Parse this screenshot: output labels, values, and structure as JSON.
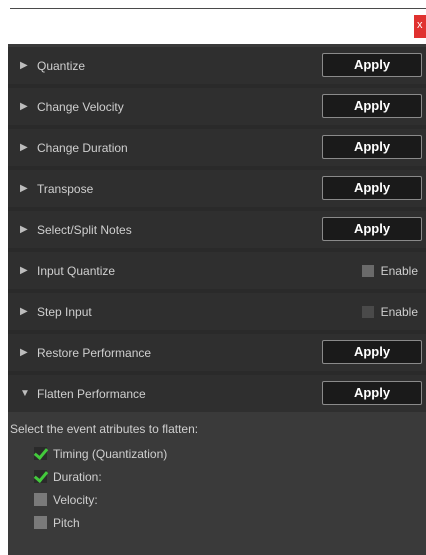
{
  "window": {
    "close_label": "x"
  },
  "rows": [
    {
      "label": "Quantize",
      "control": "Apply"
    },
    {
      "label": "Change Velocity",
      "control": "Apply"
    },
    {
      "label": "Change Duration",
      "control": "Apply"
    },
    {
      "label": "Transpose",
      "control": "Apply"
    },
    {
      "label": "Select/Split Notes",
      "control": "Apply"
    },
    {
      "label": "Input Quantize",
      "control": "Enable",
      "enabled": false
    },
    {
      "label": "Step Input",
      "control": "Enable",
      "enabled": false
    },
    {
      "label": "Restore Performance",
      "control": "Apply"
    },
    {
      "label": "Flatten Performance",
      "control": "Apply",
      "expanded": true
    }
  ],
  "flatten": {
    "prompt": "Select the event atributes to flatten:",
    "options": [
      {
        "label": "Timing (Quantization)",
        "checked": true
      },
      {
        "label": "Duration:",
        "checked": true
      },
      {
        "label": "Velocity:",
        "checked": false
      },
      {
        "label": "Pitch",
        "checked": false
      }
    ]
  },
  "colors": {
    "accent_check": "#43c93c",
    "close_red": "#e0312f"
  }
}
